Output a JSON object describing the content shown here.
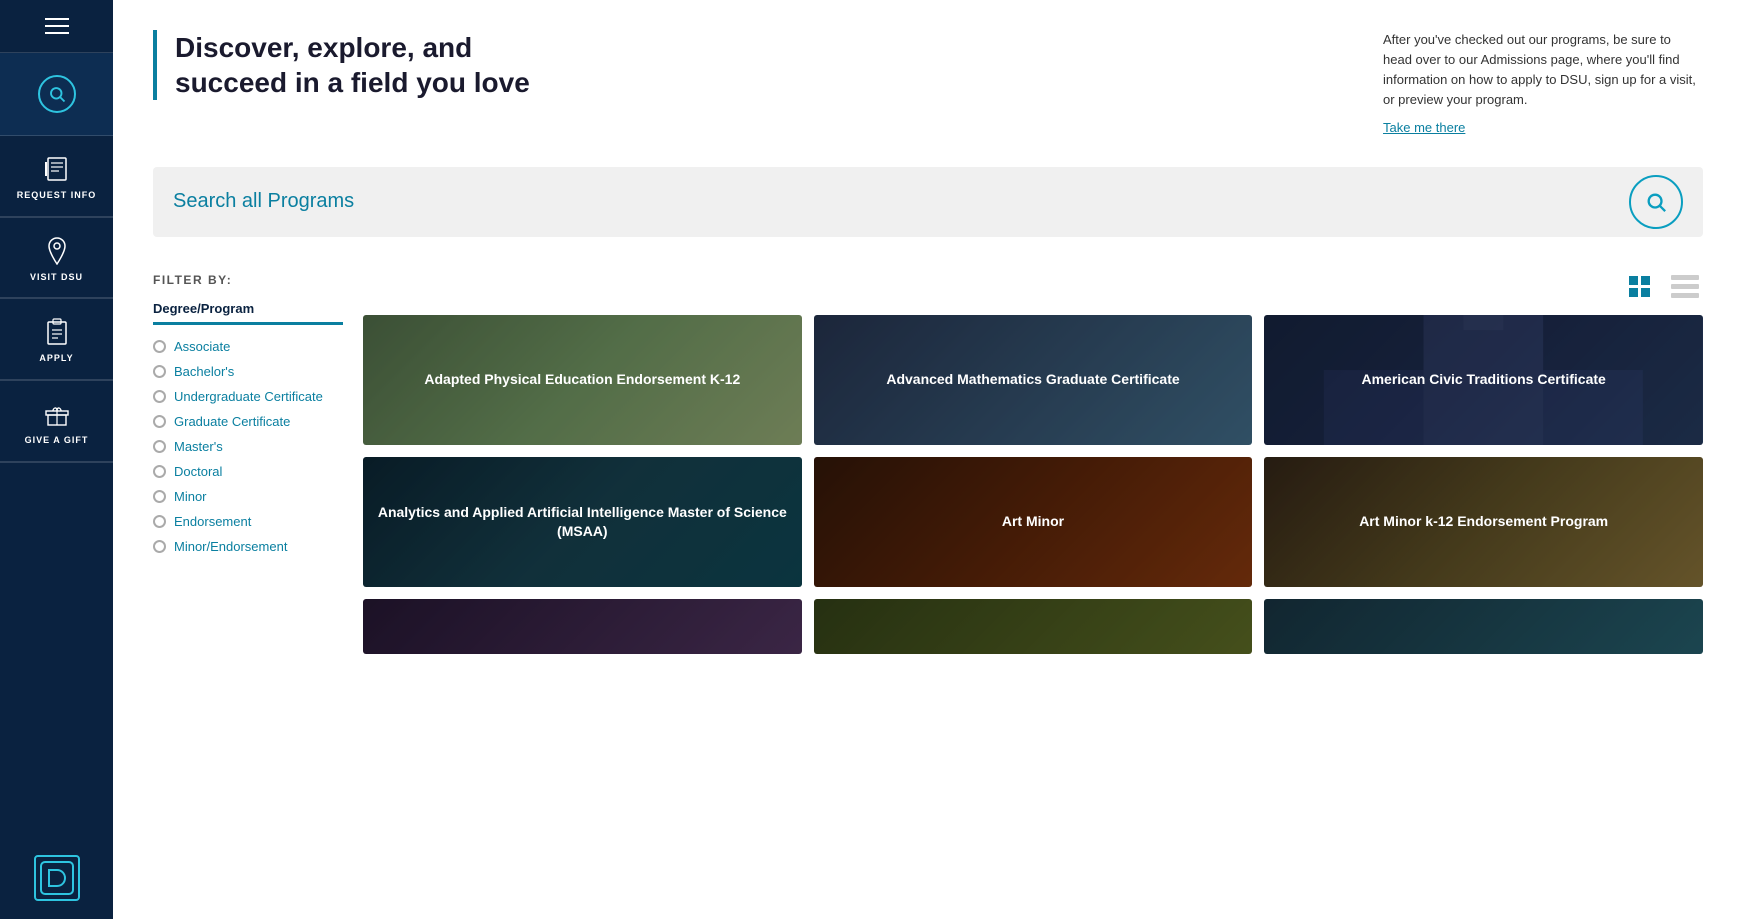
{
  "sidebar": {
    "hamburger_label": "Menu",
    "nav_items": [
      {
        "id": "request-info",
        "label": "REQUEST\nINFO",
        "icon": "notebook-icon"
      },
      {
        "id": "visit-dsu",
        "label": "VISIT\nDSU",
        "icon": "location-icon"
      },
      {
        "id": "apply",
        "label": "APPLY",
        "icon": "clipboard-icon"
      },
      {
        "id": "give-a-gift",
        "label": "GIVE\nA\nGIFT",
        "icon": "gift-icon"
      }
    ],
    "logo_text": "D"
  },
  "header": {
    "headline": "Discover, explore, and succeed in a field you love",
    "description": "After you've checked out our programs, be sure to head over to our Admissions page, where you'll find information on how to apply to DSU, sign up for a visit, or preview your program.",
    "cta_link": "Take me there"
  },
  "search": {
    "placeholder": "Search all Programs",
    "icon": "search-icon"
  },
  "filter": {
    "label": "FILTER BY:",
    "active_tab": "Degree/Program",
    "options": [
      {
        "id": "associate",
        "label": "Associate"
      },
      {
        "id": "bachelors",
        "label": "Bachelor's"
      },
      {
        "id": "undergrad-cert",
        "label": "Undergraduate Certificate"
      },
      {
        "id": "grad-cert",
        "label": "Graduate Certificate"
      },
      {
        "id": "masters",
        "label": "Master's"
      },
      {
        "id": "doctoral",
        "label": "Doctoral"
      },
      {
        "id": "minor",
        "label": "Minor"
      },
      {
        "id": "endorsement",
        "label": "Endorsement"
      },
      {
        "id": "minor-endorsement",
        "label": "Minor/Endorsement"
      }
    ]
  },
  "grid_view": {
    "grid_label": "Grid view",
    "list_label": "List view"
  },
  "programs": [
    {
      "id": "adapted-physical-ed",
      "title": "Adapted Physical Education Endorsement K-12",
      "bg_class": "bg-physical-ed"
    },
    {
      "id": "advanced-math",
      "title": "Advanced Mathematics Graduate Certificate",
      "bg_class": "bg-math"
    },
    {
      "id": "american-civic",
      "title": "American Civic Traditions Certificate",
      "bg_class": "bg-civic"
    },
    {
      "id": "analytics-ai",
      "title": "Analytics and Applied Artificial Intelligence Master of Science (MSAA)",
      "bg_class": "bg-analytics"
    },
    {
      "id": "art-minor",
      "title": "Art Minor",
      "bg_class": "bg-art-minor"
    },
    {
      "id": "art-minor-endorsement",
      "title": "Art Minor k-12 Endorsement Program",
      "bg_class": "bg-art-endorsement"
    }
  ]
}
